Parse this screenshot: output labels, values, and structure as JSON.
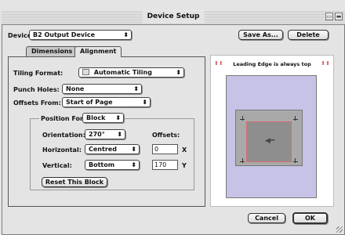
{
  "window": {
    "title": "Device Setup"
  },
  "device": {
    "label": "Device:",
    "value": "B2 Output Device",
    "save_as": "Save As...",
    "delete": "Delete"
  },
  "tabs": [
    {
      "label": "Dimensions",
      "active": false
    },
    {
      "label": "Alignment",
      "active": true
    }
  ],
  "alignment": {
    "tiling_label": "Tiling Format:",
    "tiling_value": "Automatic Tiling",
    "punch_label": "Punch Holes:",
    "punch_value": "None",
    "offsets_from_label": "Offsets From:",
    "offsets_from_value": "Start of Page",
    "position_for_label": "Position For:",
    "position_for_value": "Block",
    "orientation_label": "Orientation:",
    "orientation_value": "270°",
    "offsets_label": "Offsets:",
    "horizontal_label": "Horizontal:",
    "horizontal_value": "Centred",
    "horizontal_offset": "0",
    "x_label": "X",
    "vertical_label": "Vertical:",
    "vertical_value": "Bottom",
    "vertical_offset": "170",
    "y_label": "Y",
    "reset_label": "Reset This Block"
  },
  "preview": {
    "caption": "Leading Edge is always top"
  },
  "footer": {
    "cancel": "Cancel",
    "ok": "OK"
  },
  "colors": {
    "paper": "#c6c3e6",
    "margin": "#a9a9a9",
    "image_border": "#d96c6c",
    "background": "#1f2a36"
  }
}
